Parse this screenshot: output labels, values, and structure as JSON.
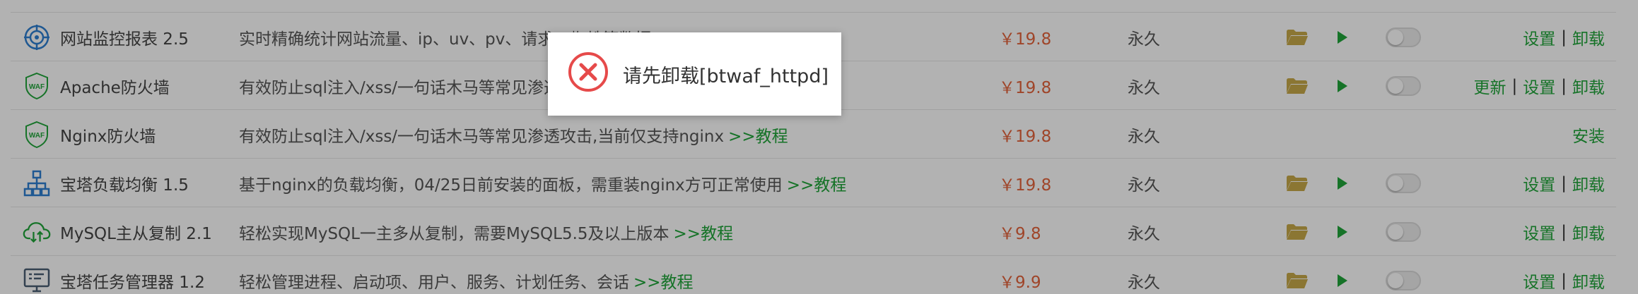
{
  "rows": [
    {
      "icon": "monitor-target-icon",
      "name": "网站监控报表 2.5",
      "desc": "实时精确统计网站流量、ip、uv、pv、请求、蜘蛛等数据",
      "link": "",
      "price": "￥19.8",
      "expire": "永久",
      "ops": [
        "设置",
        "卸载"
      ],
      "installed": true
    },
    {
      "icon": "waf-shield-icon",
      "name": "Apache防火墙",
      "desc": "有效防止sql注入/xss/一句话木马等常见渗透攻击",
      "link": "",
      "price": "￥19.8",
      "expire": "永久",
      "ops": [
        "更新",
        "设置",
        "卸载"
      ],
      "installed": true
    },
    {
      "icon": "waf-shield-icon",
      "name": "Nginx防火墙",
      "desc": "有效防止sql注入/xss/一句话木马等常见渗透攻击,当前仅支持nginx",
      "link": ">>教程",
      "price": "￥19.8",
      "expire": "永久",
      "ops": [
        "安装"
      ],
      "installed": false
    },
    {
      "icon": "load-balance-icon",
      "name": "宝塔负载均衡 1.5",
      "desc": "基于nginx的负载均衡，04/25日前安装的面板，需重装nginx方可正常使用",
      "link": ">>教程",
      "price": "￥19.8",
      "expire": "永久",
      "ops": [
        "设置",
        "卸载"
      ],
      "installed": true
    },
    {
      "icon": "cloud-sync-icon",
      "name": "MySQL主从复制 2.1",
      "desc": "轻松实现MySQL一主多从复制，需要MySQL5.5及以上版本",
      "link": ">>教程",
      "price": "￥9.8",
      "expire": "永久",
      "ops": [
        "设置",
        "卸载"
      ],
      "installed": true
    },
    {
      "icon": "task-manager-icon",
      "name": "宝塔任务管理器 1.2",
      "desc": "轻松管理进程、启动项、用户、服务、计划任务、会话",
      "link": ">>教程",
      "price": "￥9.9",
      "expire": "永久",
      "ops": [
        "设置",
        "卸载"
      ],
      "installed": true
    }
  ],
  "dialog": {
    "icon": "error-icon",
    "message": "请先卸载[btwaf_httpd]"
  },
  "colors": {
    "green": "#20a53a",
    "price": "#e4633b",
    "error": "#e64a4a",
    "folder": "#c8a94a"
  }
}
